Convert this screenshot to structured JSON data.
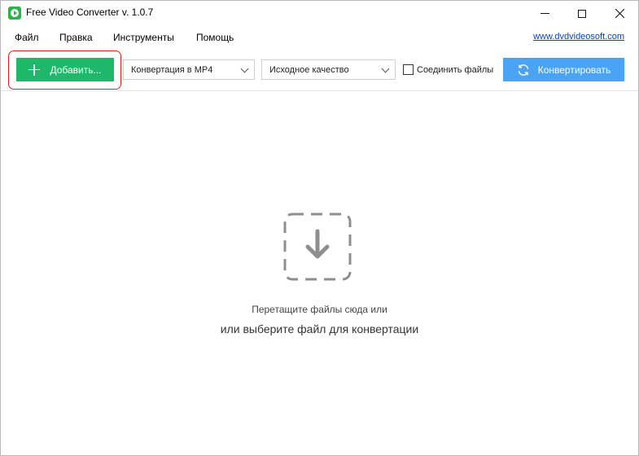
{
  "window": {
    "title": "Free Video Converter v. 1.0.7"
  },
  "menu": {
    "items": [
      "Файл",
      "Правка",
      "Инструменты",
      "Помощь"
    ],
    "site_link": "www.dvdvideosoft.com"
  },
  "toolbar": {
    "add_label": "Добавить...",
    "format_selected": "Конвертация в MP4",
    "quality_selected": "Исходное качество",
    "join_label": "Соединить файлы",
    "join_checked": false,
    "convert_label": "Конвертировать",
    "add_color": "#1fb86a",
    "convert_color": "#4aa3f3",
    "highlight_color": "#e02020"
  },
  "drop": {
    "line1": "Перетащите файлы сюда или",
    "line2": "или выберите файл для конвертации"
  },
  "icons": {
    "app": "app-logo-icon",
    "add": "plus-icon",
    "convert": "refresh-icon",
    "drop": "download-arrow-icon"
  }
}
